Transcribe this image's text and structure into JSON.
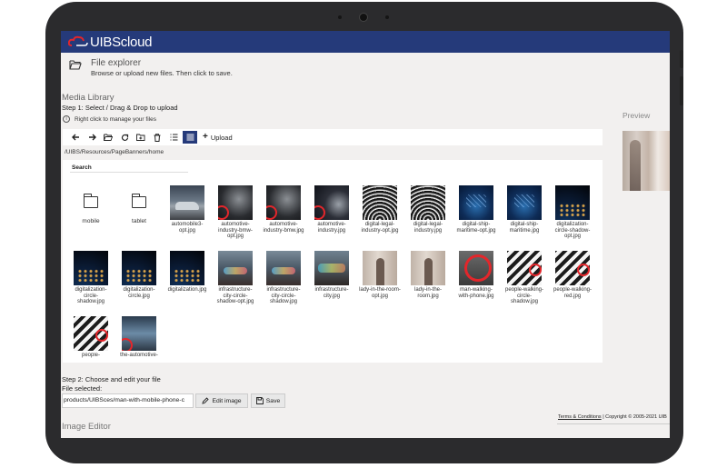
{
  "app": {
    "logo_text": "UIBScloud",
    "brand_color": "#253a7a",
    "accent_color": "#e3262b"
  },
  "header": {
    "title": "File explorer",
    "subtitle": "Browse or upload new files. Then click to save."
  },
  "media_library": {
    "title": "Media Library",
    "step1": "Step 1: Select / Drag & Drop to upload",
    "hint": "Right click to manage your files",
    "toolbar": {
      "upload_label": "Upload",
      "icons": [
        "back-icon",
        "forward-icon",
        "open-folder-icon",
        "refresh-icon",
        "new-folder-icon",
        "delete-icon",
        "list-view-icon",
        "grid-view-icon",
        "plus-icon"
      ]
    },
    "path": "/UIBS/Resources/PageBanners/home",
    "search_label": "Search",
    "folders": [
      "mobile",
      "tablet"
    ],
    "files": [
      "automobile3-opt.jpg",
      "automotive-industry-bmw-opt.jpg",
      "automotive-industry-bmw.jpg",
      "automotive-industry.jpg",
      "digital-legal-industry-opt.jpg",
      "digital-legal-industry.jpg",
      "digital-ship-maritime-opt.jpg",
      "digital-ship-maritime.jpg",
      "digitalization-circle-shadow-opt.jpg",
      "digitalization-circle-shadow.jpg",
      "digitalization-circle.jpg",
      "digitalization.jpg",
      "infrastructure-city-circle-shadow-opt.jpg",
      "infrastructure-city-circle-shadow.jpg",
      "infrastructure-city.jpg",
      "lady-in-the-room-opt.jpg",
      "lady-in-the-room.jpg",
      "man-walking-with-phone.jpg",
      "people-walking-circle-shadow.jpg",
      "people-walking-red.jpg",
      "people-walking.jpg",
      "the-automotive-"
    ]
  },
  "preview": {
    "label": "Preview"
  },
  "step2": {
    "title": "Step 2: Choose and edit your file",
    "file_selected_label": "File selected:",
    "file_value": "products/UIBSces/man-with-mobile-phone-c",
    "edit_label": "Edit image",
    "save_label": "Save"
  },
  "footer": {
    "terms": "Terms & Conditions",
    "copyright": "| Copyright © 2005-2021 UIB"
  },
  "image_editor": {
    "title": "Image Editor"
  }
}
